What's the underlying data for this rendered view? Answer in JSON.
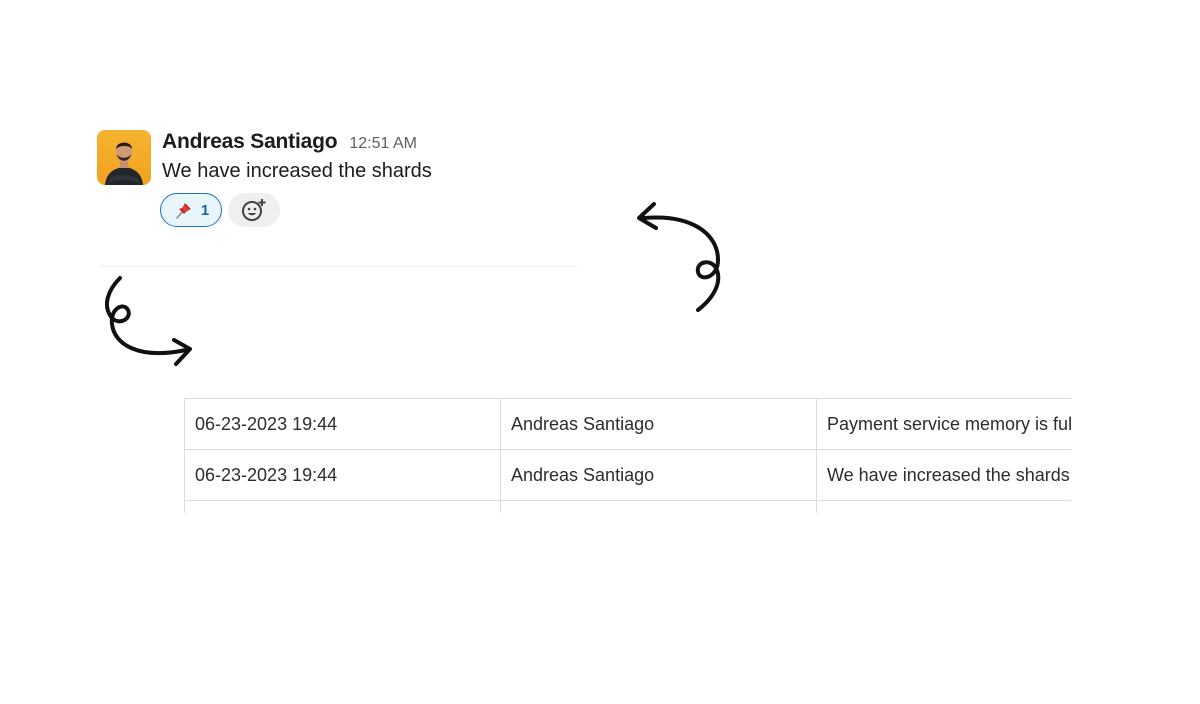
{
  "message": {
    "sender": "Andreas Santiago",
    "time": "12:51 AM",
    "text": "We have increased the shards",
    "reactions": [
      {
        "icon": "pushpin-icon",
        "count": "1"
      }
    ],
    "add_reaction_icon": "add-emoji-icon"
  },
  "table": {
    "rows": [
      {
        "timestamp": "06-23-2023 19:44",
        "user": "Andreas Santiago",
        "message": "Payment service memory is full"
      },
      {
        "timestamp": "06-23-2023 19:44",
        "user": "Andreas Santiago",
        "message": "We have increased the shards"
      }
    ]
  },
  "colors": {
    "reaction_border": "#1d74c5",
    "reaction_bg": "#e8f5fa",
    "avatar_bg": "#f6b431"
  }
}
